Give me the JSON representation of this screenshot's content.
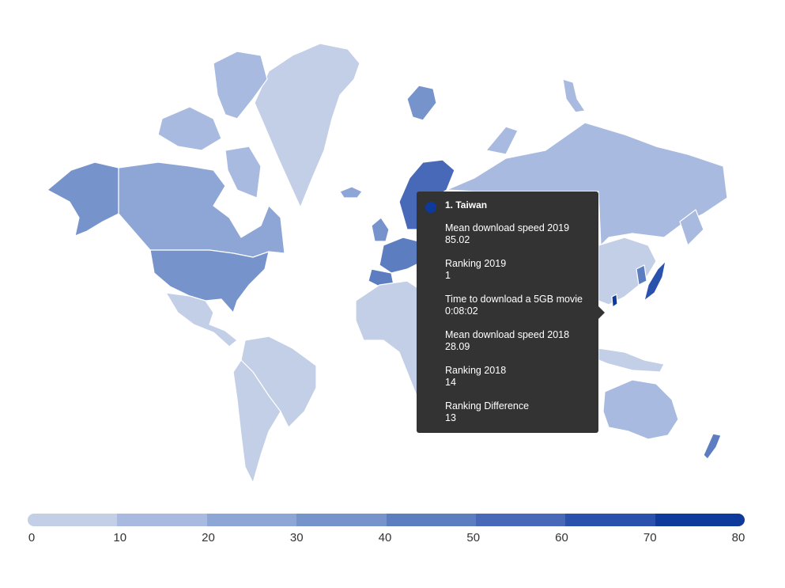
{
  "map": {
    "colors": {
      "c0": "#c2cfe6",
      "c1": "#a8badf",
      "c2": "#8ea6d6",
      "c3": "#7693cc",
      "c4": "#5c7ec1",
      "c5": "#4769b8",
      "c6": "#2a52ad",
      "c7": "#0e3a9c"
    }
  },
  "tooltip": {
    "title": "1. Taiwan",
    "dot_color": "#0e3a9c",
    "rows": [
      {
        "label": "Mean download speed 2019",
        "value": "85.02"
      },
      {
        "label": "Ranking 2019",
        "value": "1"
      },
      {
        "label": "Time to download a 5GB movie",
        "value": "0:08:02"
      },
      {
        "label": "Mean download speed 2018",
        "value": "28.09"
      },
      {
        "label": "Ranking 2018",
        "value": "14"
      },
      {
        "label": "Ranking Difference",
        "value": "13"
      }
    ]
  },
  "legend": {
    "ticks": [
      "0",
      "10",
      "20",
      "30",
      "40",
      "50",
      "60",
      "70",
      "80"
    ],
    "colors": [
      "#c2cfe6",
      "#a8badf",
      "#8ea6d6",
      "#7693cc",
      "#5c7ec1",
      "#4769b8",
      "#2a52ad",
      "#0e3a9c"
    ]
  }
}
